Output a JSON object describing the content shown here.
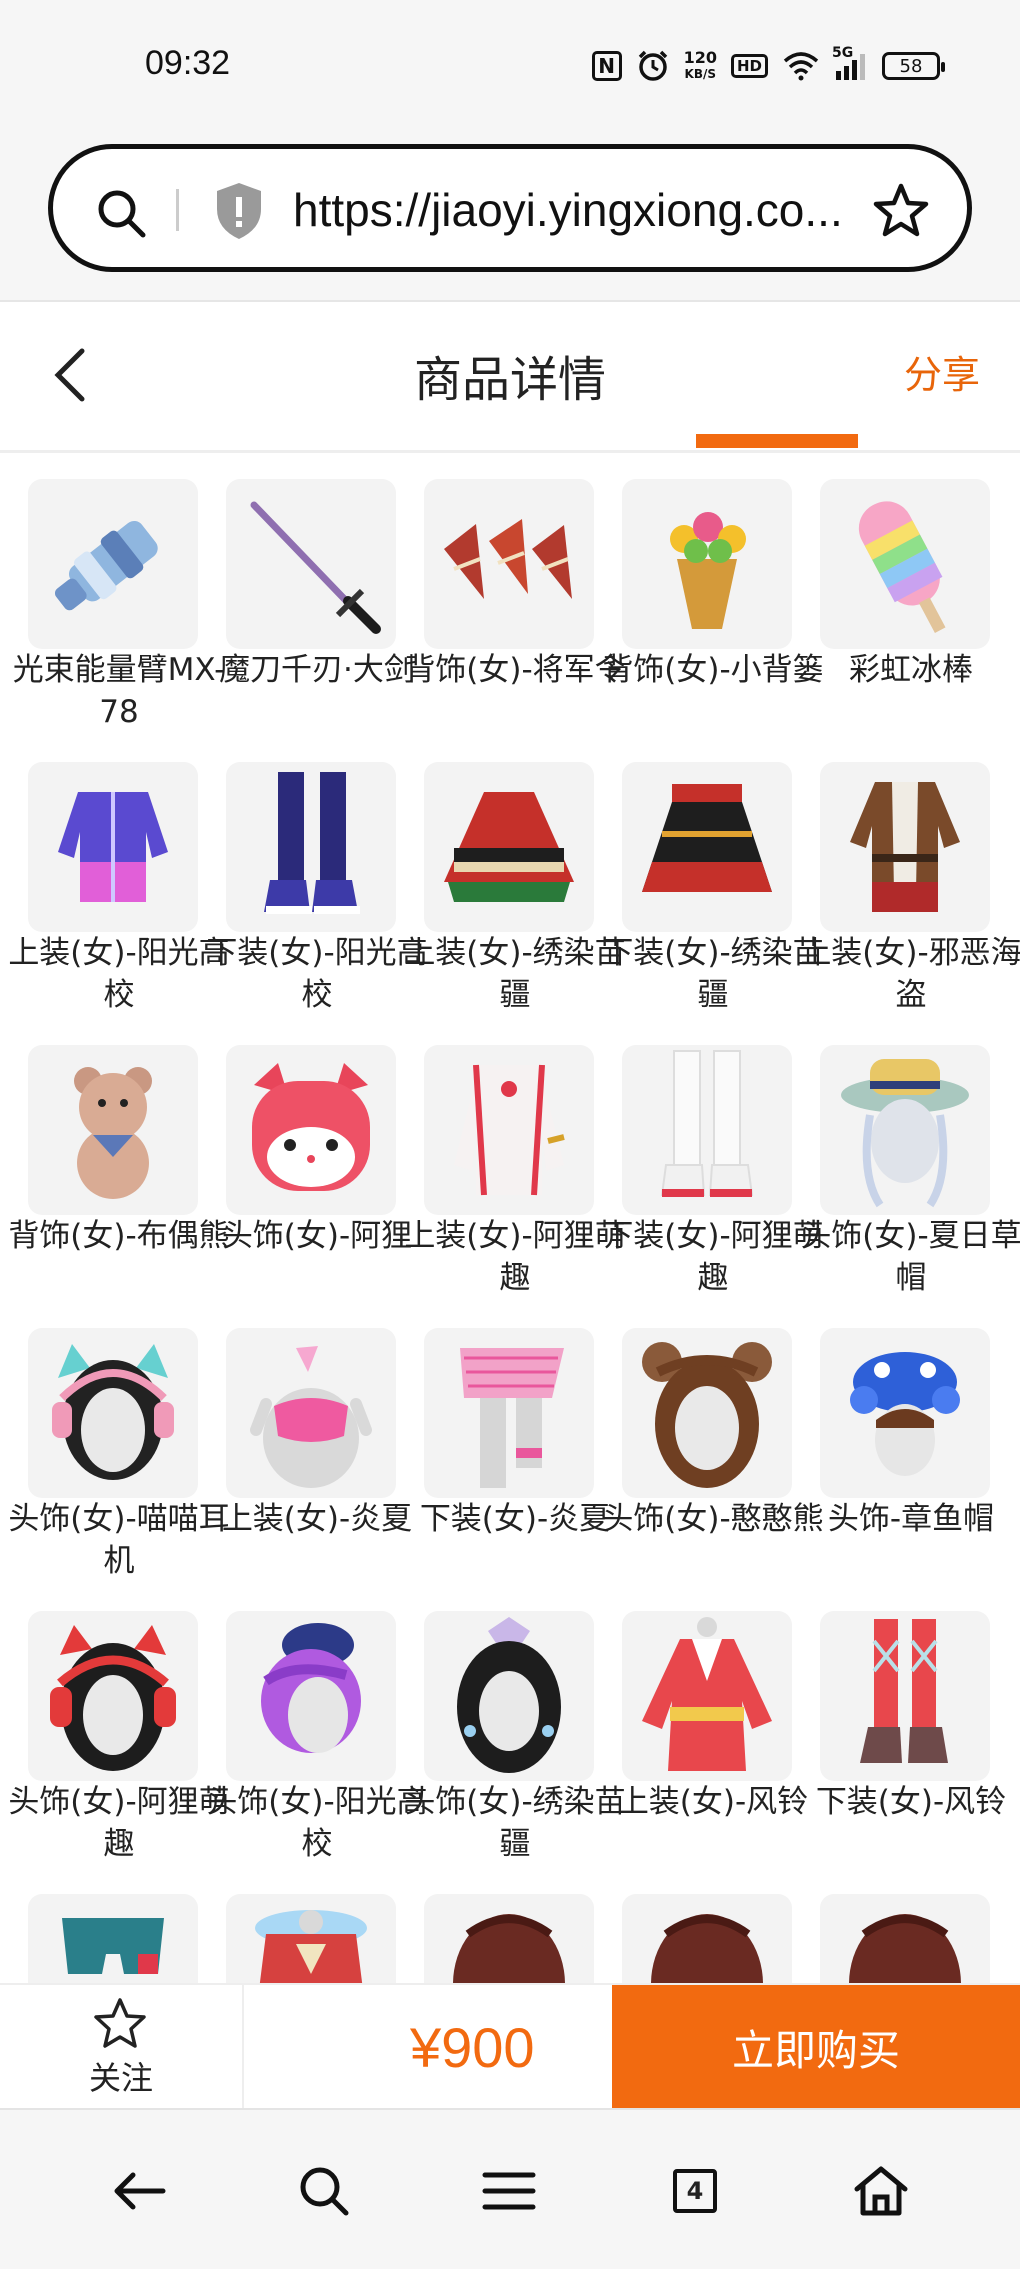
{
  "status": {
    "time": "09:32",
    "nfc": "N",
    "speed_value": "120",
    "speed_unit": "KB/S",
    "hd": "HD",
    "signal": "5G",
    "battery": "58"
  },
  "browser": {
    "url": "https://jiaoyi.yingxiong.co..."
  },
  "header": {
    "title": "商品详情",
    "share": "分享"
  },
  "items": [
    {
      "label": "光束能量臂MX-78"
    },
    {
      "label": "魔刀千刃·大剑"
    },
    {
      "label": "背饰(女)-将军令"
    },
    {
      "label": "背饰(女)-小背篓"
    },
    {
      "label": "彩虹冰棒"
    },
    {
      "label": "上装(女)-阳光高校"
    },
    {
      "label": "下装(女)-阳光高校"
    },
    {
      "label": "上装(女)-绣染苗疆"
    },
    {
      "label": "下装(女)-绣染苗疆"
    },
    {
      "label": "上装(女)-邪恶海盗"
    },
    {
      "label": "背饰(女)-布偶熊"
    },
    {
      "label": "头饰(女)-阿狸"
    },
    {
      "label": "上装(女)-阿狸萌趣"
    },
    {
      "label": "下装(女)-阿狸萌趣"
    },
    {
      "label": "头饰(女)-夏日草帽"
    },
    {
      "label": "头饰(女)-喵喵耳机"
    },
    {
      "label": "上装(女)-炎夏"
    },
    {
      "label": "下装(女)-炎夏"
    },
    {
      "label": "头饰(女)-憨憨熊"
    },
    {
      "label": "头饰-章鱼帽"
    },
    {
      "label": "头饰(女)-阿狸萌趣"
    },
    {
      "label": "头饰(女)-阳光高校"
    },
    {
      "label": "头饰(女)-绣染苗疆"
    },
    {
      "label": "上装(女)-风铃"
    },
    {
      "label": "下装(女)-风铃"
    },
    {
      "label": ""
    },
    {
      "label": ""
    },
    {
      "label": ""
    },
    {
      "label": ""
    },
    {
      "label": ""
    }
  ],
  "action": {
    "follow": "关注",
    "price": "¥900",
    "buy": "立即购买"
  },
  "nav": {
    "tabs_count": "4"
  },
  "colors": {
    "accent": "#f26a10",
    "share": "#e8650a"
  }
}
